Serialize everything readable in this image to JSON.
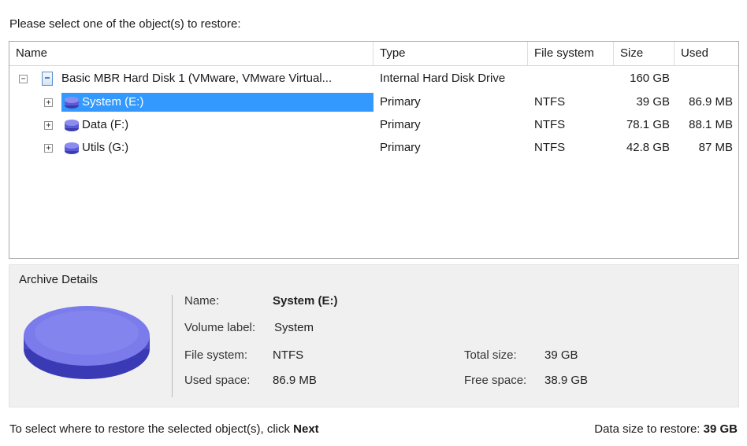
{
  "prompt": "Please select one of the object(s) to restore:",
  "columns": {
    "name": "Name",
    "type": "Type",
    "fs": "File system",
    "size": "Size",
    "used": "Used"
  },
  "disk": {
    "name": "Basic MBR Hard Disk 1 (VMware, VMware Virtual...",
    "type": "Internal Hard Disk Drive",
    "size": "160 GB"
  },
  "volumes": [
    {
      "name": "System (E:)",
      "type": "Primary",
      "fs": "NTFS",
      "size": "39 GB",
      "used": "86.9 MB",
      "selected": true
    },
    {
      "name": "Data (F:)",
      "type": "Primary",
      "fs": "NTFS",
      "size": "78.1 GB",
      "used": "88.1 MB",
      "selected": false
    },
    {
      "name": "Utils (G:)",
      "type": "Primary",
      "fs": "NTFS",
      "size": "42.8 GB",
      "used": "87 MB",
      "selected": false
    }
  ],
  "details": {
    "title": "Archive Details",
    "name_label": "Name:",
    "name_value": "System (E:)",
    "volume_label_label": "Volume label:",
    "volume_label_value": "System",
    "fs_label": "File system:",
    "fs_value": "NTFS",
    "used_label": "Used space:",
    "used_value": "86.9 MB",
    "total_label": "Total size:",
    "total_value": "39 GB",
    "free_label": "Free space:",
    "free_value": "38.9 GB"
  },
  "footer": {
    "instruction_prefix": "To select where to restore the selected object(s), click ",
    "instruction_next": "Next",
    "data_size_label": "Data size to restore: ",
    "data_size_value": "39 GB"
  },
  "icons": {
    "expander_collapse": "minus-box-icon",
    "expander_expand": "plus-box-icon",
    "disk": "hard-disk-icon",
    "volume": "volume-icon",
    "archive": "disk-platter-icon"
  },
  "colors": {
    "selection": "#3399ff",
    "volume_icon": "#5b5bd6",
    "panel": "#f0f0f0"
  }
}
